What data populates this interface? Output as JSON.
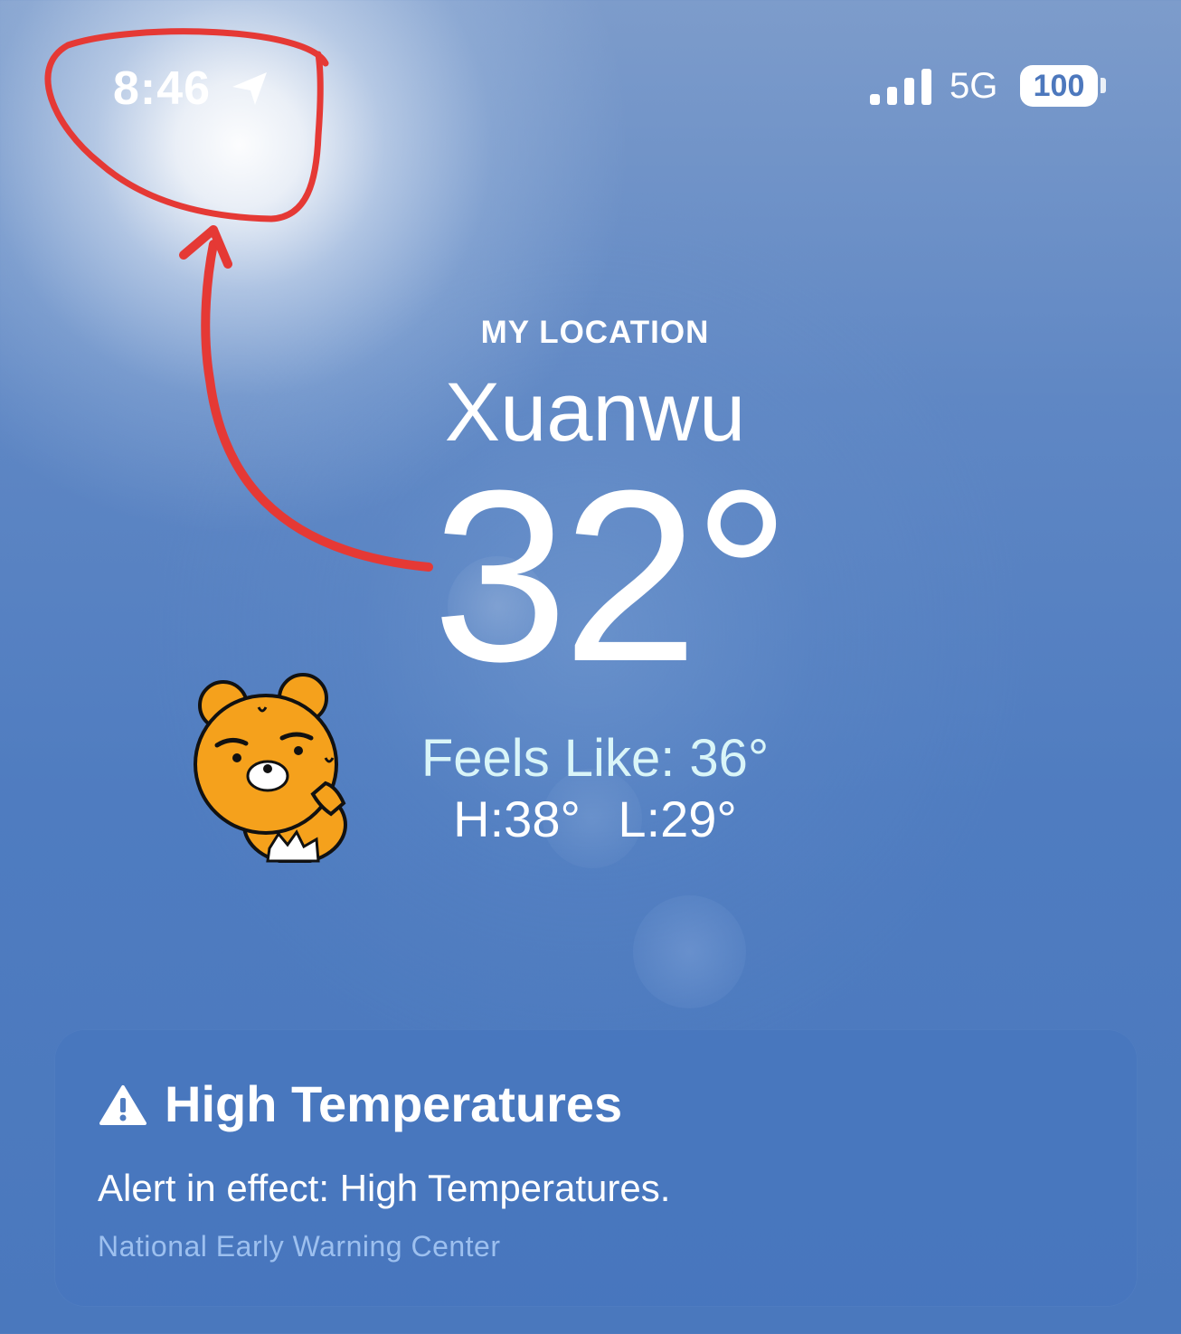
{
  "status_bar": {
    "time": "8:46",
    "location_icon": "location-arrow-icon",
    "signal_icon": "cellular-signal-icon",
    "network": "5G",
    "battery": "100"
  },
  "weather": {
    "location_caption": "MY LOCATION",
    "city": "Xuanwu",
    "temperature": "32°",
    "feels_like": "Feels Like: 36°",
    "high": "H:38°",
    "low": "L:29°"
  },
  "alert": {
    "icon": "warning-triangle-icon",
    "title": "High Temperatures",
    "body": "Alert in effect: High Temperatures.",
    "source": "National Early Warning Center"
  },
  "colors": {
    "background_top": "#7d9ccb",
    "background_bottom": "#4a78bd",
    "annotation_red": "#e53935",
    "feels_like_text": "#d9f5f8",
    "alert_source_text": "#9dc0ef"
  }
}
